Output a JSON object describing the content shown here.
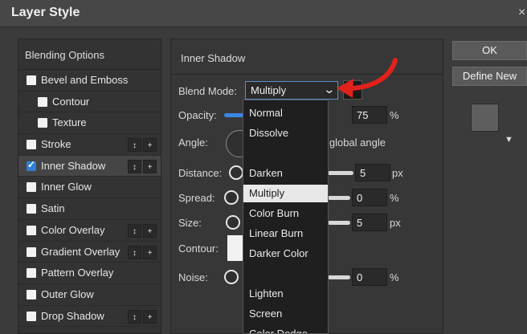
{
  "window": {
    "title": "Layer Style",
    "close_glyph": "×"
  },
  "left_panel": {
    "header": "Blending Options",
    "effects": [
      {
        "label": "Bevel and Emboss",
        "checked": false,
        "indent": false,
        "has_buttons": false
      },
      {
        "label": "Contour",
        "checked": false,
        "indent": true,
        "has_buttons": false
      },
      {
        "label": "Texture",
        "checked": false,
        "indent": true,
        "has_buttons": false
      },
      {
        "label": "Stroke",
        "checked": false,
        "indent": false,
        "has_buttons": true
      },
      {
        "label": "Inner Shadow",
        "checked": true,
        "indent": false,
        "has_buttons": true,
        "active": true
      },
      {
        "label": "Inner Glow",
        "checked": false,
        "indent": false,
        "has_buttons": false
      },
      {
        "label": "Satin",
        "checked": false,
        "indent": false,
        "has_buttons": false
      },
      {
        "label": "Color Overlay",
        "checked": false,
        "indent": false,
        "has_buttons": true
      },
      {
        "label": "Gradient Overlay",
        "checked": false,
        "indent": false,
        "has_buttons": true
      },
      {
        "label": "Pattern Overlay",
        "checked": false,
        "indent": false,
        "has_buttons": false
      },
      {
        "label": "Outer Glow",
        "checked": false,
        "indent": false,
        "has_buttons": false
      },
      {
        "label": "Drop Shadow",
        "checked": false,
        "indent": false,
        "has_buttons": true
      }
    ],
    "move_glyph": "↕",
    "add_glyph": "+"
  },
  "inner_shadow": {
    "section_title": "Inner Shadow",
    "blend_mode_label": "Blend Mode:",
    "blend_mode_value": "Multiply",
    "opacity_label": "Opacity:",
    "opacity_value": "75",
    "opacity_unit": "%",
    "angle_label": "Angle:",
    "global_angle_label": "e global angle",
    "distance_label": "Distance:",
    "distance_value": "5",
    "distance_unit": "px",
    "spread_label": "Spread:",
    "spread_value": "0",
    "spread_unit": "%",
    "size_label": "Size:",
    "size_value": "5",
    "size_unit": "px",
    "contour_label": "Contour:",
    "noise_label": "Noise:",
    "noise_value": "0",
    "noise_unit": "%",
    "shadow_color": "#1a1a1a"
  },
  "blend_dropdown": {
    "items": [
      "Normal",
      "Dissolve",
      "",
      "Darken",
      "Multiply",
      "Color Burn",
      "Linear Burn",
      "Darker Color",
      "",
      "Lighten",
      "Screen",
      "Color Dodge"
    ],
    "selected": "Multiply"
  },
  "buttons": {
    "ok": "OK",
    "define_new": "Define New"
  },
  "colors": {
    "accent": "#3a86e6",
    "annotation_arrow": "#e0221b"
  },
  "icons": {
    "dropdown_chevron": "⌄",
    "preview_toggle": "▼"
  }
}
